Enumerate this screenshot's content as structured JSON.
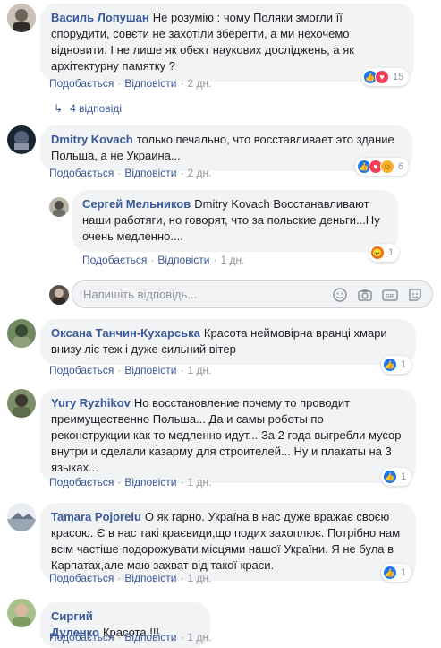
{
  "comments": [
    {
      "name": "Василь Лопушан",
      "text": "Не розумію : чому Поляки змогли її спорудити, совєти не захотіли зберегти, а ми нехочемо відновити. І не лише як обєкт наукових досліджень, а як архітектурну памятку ?",
      "like": "Подобається",
      "reply": "Відповісти",
      "time": "2 дн.",
      "reactions": "15"
    },
    {
      "name": "Dmitry Kovach",
      "text": "только печально, что восставливает это здание Польша, а не Украина...",
      "like": "Подобається",
      "reply": "Відповісти",
      "time": "2 дн.",
      "reactions": "6"
    },
    {
      "name": "Сергей Мельников",
      "text": "Dmitry Kovach Восстанавливают наши работяги, но говорят, что за польские деньги...Ну очень медленно....",
      "like": "Подобається",
      "reply": "Відповісти",
      "time": "1 дн.",
      "reactions": "1"
    },
    {
      "name": "Оксана Танчин-Кухарська",
      "text": "Красота неймовірна вранці хмари внизу ліс теж і дуже сильний вітер",
      "like": "Подобається",
      "reply": "Відповісти",
      "time": "1 дн.",
      "reactions": "1"
    },
    {
      "name": "Yury Ryzhikov",
      "text": "Но восстановление почему то проводит преимущественно Польша... Да и самы роботы по реконструкции как то медленно идут... За 2 года выгребли мусор внутри и сделали казарму для строителей... Ну и плакаты на 3 языках...",
      "like": "Подобається",
      "reply": "Відповісти",
      "time": "1 дн.",
      "reactions": "1"
    },
    {
      "name": "Tamara Pojorelu",
      "text": "О як гарно. Україна в нас дуже вражає своєю красою. Є в нас такі краєвиди,що подих захоплює. Потрібно нам всім частіше подорожувати місцями нашої України. Я не була в Карпатах,але маю захват від такої краси.",
      "like": "Подобається",
      "reply": "Відповісти",
      "time": "1 дн.",
      "reactions": "1"
    },
    {
      "name": "Сиргий Дуленко",
      "text": "Красота.!!!",
      "like": "Подобається",
      "reply": "Відповісти",
      "time": "1 дн."
    }
  ],
  "replies_link": "4 відповіді",
  "reply_input": {
    "placeholder": "Напишіть відповідь..."
  },
  "icons": [
    "camera-icon",
    "smile-icon",
    "gif-icon",
    "sticker-icon",
    "like-icon",
    "love-icon",
    "haha-icon",
    "angry-icon"
  ]
}
